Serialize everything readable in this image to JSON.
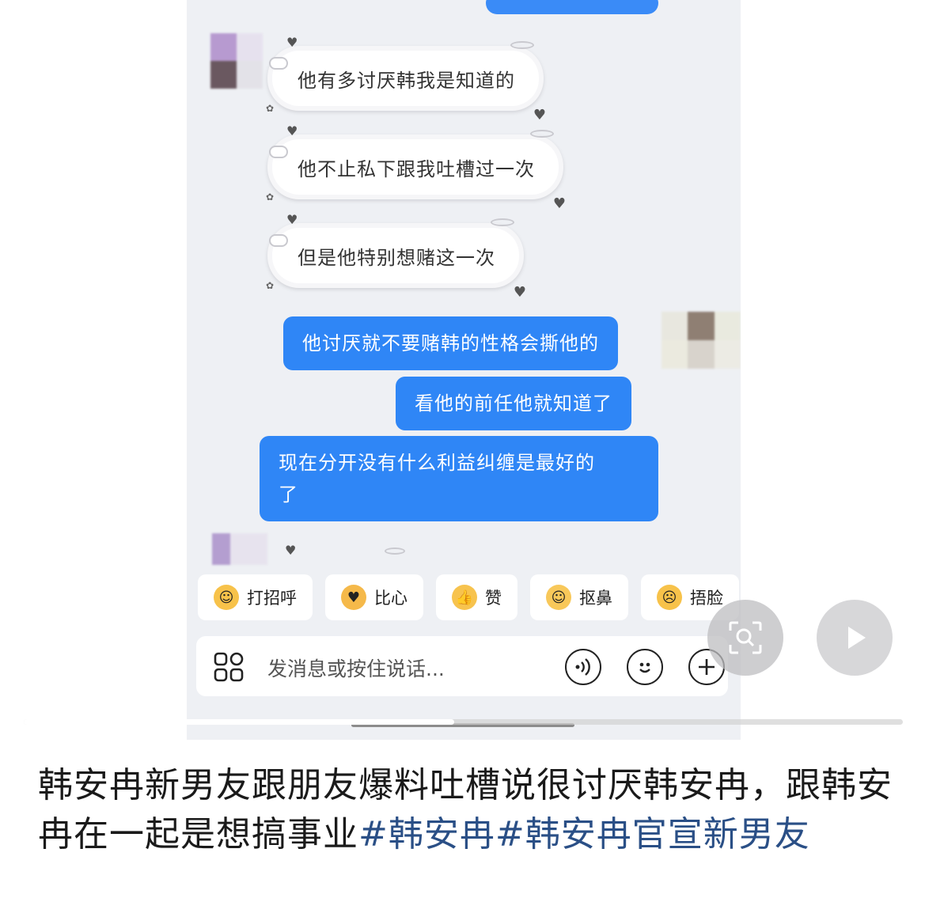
{
  "chat": {
    "incoming_messages": [
      {
        "text": "他有多讨厌韩我是知道的"
      },
      {
        "text": "他不止私下跟我吐槽过一次"
      },
      {
        "text": "但是他特别想赌这一次"
      }
    ],
    "outgoing_messages": [
      {
        "text": "他讨厌就不要赌韩的性格会撕他的"
      },
      {
        "text": "看他的前任他就知道了"
      },
      {
        "text_line1": "现在分开没有什么利益纠缠是最好的",
        "text_line2": "了"
      }
    ],
    "quick_replies": [
      {
        "label": "打招呼",
        "icon": "waving-face-icon"
      },
      {
        "label": "比心",
        "icon": "heart-hands-icon"
      },
      {
        "label": "赞",
        "icon": "thumbs-up-icon"
      },
      {
        "label": "抠鼻",
        "icon": "nose-picking-icon"
      },
      {
        "label": "捂脸",
        "icon": "facepalm-icon"
      }
    ],
    "input": {
      "placeholder": "发消息或按住说话..."
    },
    "colors": {
      "outgoing_bubble": "#2f86f6",
      "background": "#eef0f4"
    }
  },
  "video": {
    "progress": 0.49
  },
  "caption": {
    "text": "韩安冉新男友跟朋友爆料吐槽说很讨厌韩安冉，跟韩安冉在一起是想搞事业",
    "hashtag1": "#韩安冉",
    "hashtag2": "#韩安冉官宣新男友",
    "colors": {
      "hashtag": "#2a4f86"
    }
  }
}
